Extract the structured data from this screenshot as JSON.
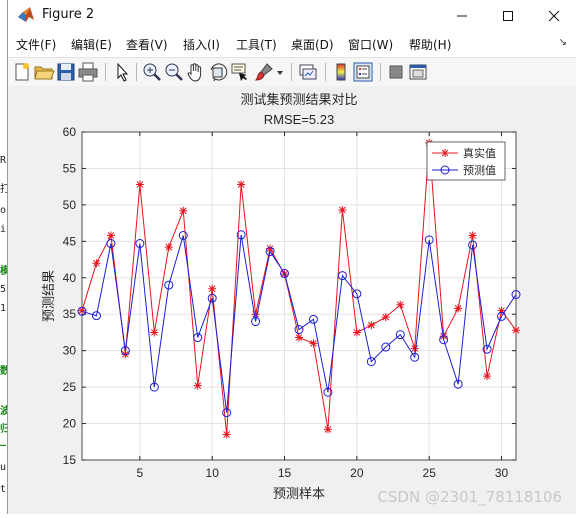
{
  "window": {
    "title": "Figure 2"
  },
  "menu": [
    "文件(F)",
    "编辑(E)",
    "查看(V)",
    "插入(I)",
    "工具(T)",
    "桌面(D)",
    "窗口(W)",
    "帮助(H)"
  ],
  "toolbar_icons": [
    "new-figure-icon",
    "open-file-icon",
    "save-icon",
    "print-icon",
    "edit-plot-arrow-icon",
    "zoom-in-icon",
    "zoom-out-icon",
    "pan-hand-icon",
    "rotate-3d-icon",
    "data-cursor-icon",
    "brush-icon",
    "brush-dropdown-icon",
    "link-plot-icon",
    "insert-colorbar-icon",
    "insert-legend-icon",
    "hide-plot-tools-icon",
    "show-plot-tools-icon"
  ],
  "background_text": [
    "R",
    "打",
    "o",
    "i",
    "模",
    "5",
    "1",
    "数",
    "波",
    "归",
    "—",
    "u",
    "t"
  ],
  "watermark": "CSDN @2301_78118106",
  "chart_data": {
    "type": "line",
    "title": "测试集预测结果对比",
    "subtitle": "RMSE=5.23",
    "xlabel": "预测样本",
    "ylabel": "预测结果",
    "xlim": [
      1,
      31
    ],
    "ylim": [
      15,
      60
    ],
    "xticks": [
      5,
      10,
      15,
      20,
      25,
      30
    ],
    "yticks": [
      15,
      20,
      25,
      30,
      35,
      40,
      45,
      50,
      55,
      60
    ],
    "grid": true,
    "legend_position": "top-right",
    "x": [
      1,
      2,
      3,
      4,
      5,
      6,
      7,
      8,
      9,
      10,
      11,
      12,
      13,
      14,
      15,
      16,
      17,
      18,
      19,
      20,
      21,
      22,
      23,
      24,
      25,
      26,
      27,
      28,
      29,
      30,
      31
    ],
    "series": [
      {
        "name": "真实值",
        "color": "#e8141e",
        "marker": "star",
        "values": [
          35.5,
          42.0,
          45.8,
          29.5,
          52.8,
          32.5,
          44.2,
          49.2,
          25.2,
          38.5,
          18.5,
          52.8,
          35.0,
          44.0,
          40.5,
          31.8,
          31.0,
          19.2,
          49.3,
          32.5,
          33.5,
          34.6,
          36.3,
          30.3,
          58.5,
          32.0,
          35.8,
          45.8,
          26.5,
          35.5,
          32.8
        ]
      },
      {
        "name": "预测值",
        "color": "#1e1ed2",
        "marker": "circle",
        "values": [
          35.4,
          34.8,
          44.7,
          30.0,
          44.7,
          25.0,
          39.0,
          45.8,
          31.8,
          37.2,
          21.5,
          45.9,
          34.0,
          43.6,
          40.6,
          32.9,
          34.3,
          24.3,
          40.3,
          37.8,
          28.5,
          30.5,
          32.2,
          29.1,
          45.2,
          31.5,
          25.4,
          44.5,
          30.2,
          34.7,
          37.7
        ]
      }
    ]
  }
}
